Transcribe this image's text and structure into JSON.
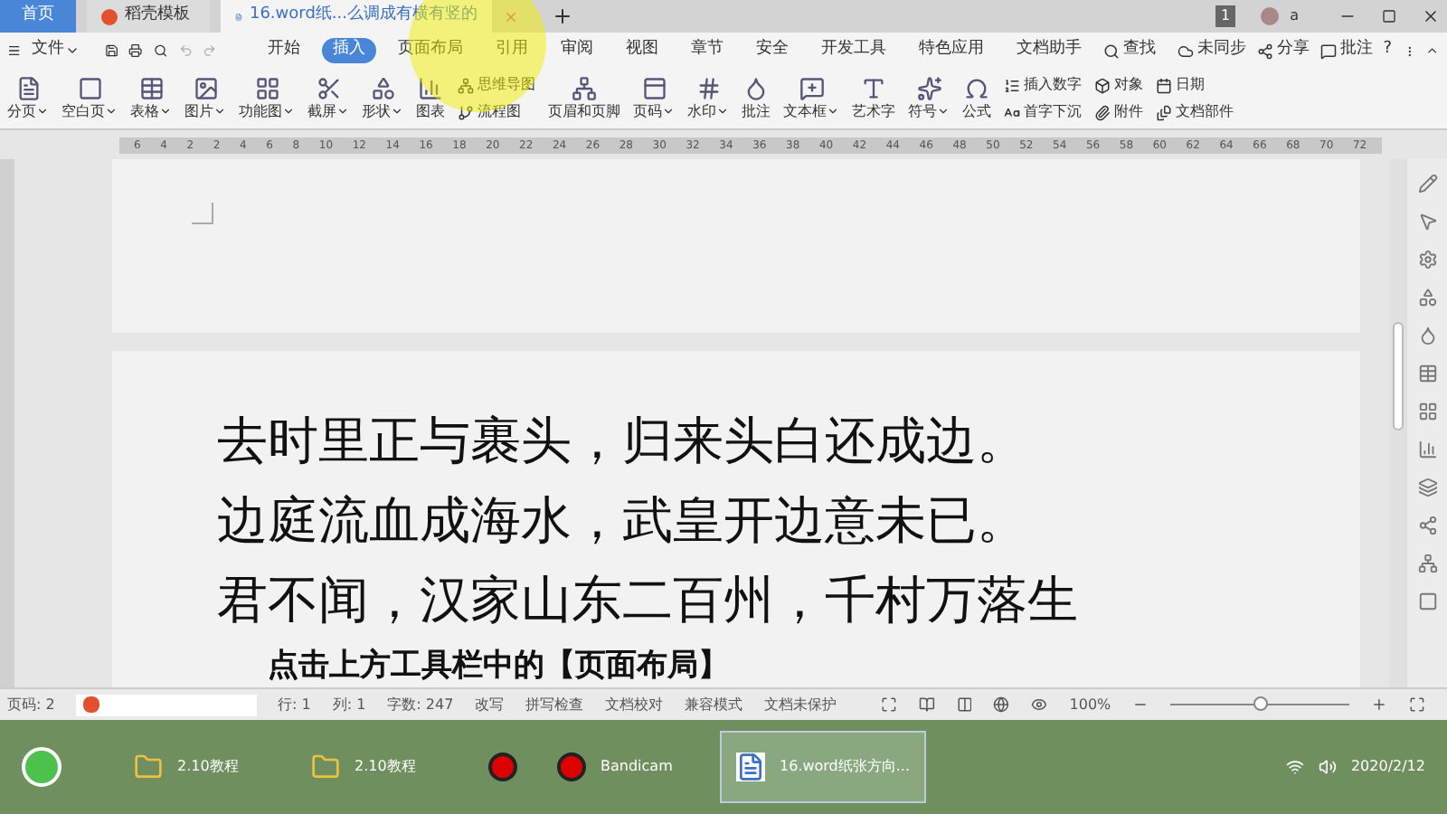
{
  "title_tabs": [
    {
      "label": "首页",
      "kind": "home",
      "selected": false
    },
    {
      "label": "稻壳模板",
      "kind": "template",
      "selected": false
    },
    {
      "label": "16.word纸...么调成有横有竖的",
      "kind": "doc",
      "selected": true
    }
  ],
  "title_bar": {
    "badge": "1",
    "user": "a"
  },
  "menu": {
    "file": "文件",
    "tabs": [
      {
        "label": "开始",
        "selected": false
      },
      {
        "label": "插入",
        "selected": true
      },
      {
        "label": "页面布局",
        "selected": false
      },
      {
        "label": "引用",
        "selected": false
      },
      {
        "label": "审阅",
        "selected": false
      },
      {
        "label": "视图",
        "selected": false
      },
      {
        "label": "章节",
        "selected": false
      },
      {
        "label": "安全",
        "selected": false
      },
      {
        "label": "开发工具",
        "selected": false
      },
      {
        "label": "特色应用",
        "selected": false
      },
      {
        "label": "文档助手",
        "selected": false
      }
    ],
    "search": "查找",
    "sync": "未同步",
    "share": "分享",
    "comment": "批注",
    "help": "?"
  },
  "ribbon": [
    {
      "kind": "big",
      "label": "分页",
      "dropdown": true
    },
    {
      "kind": "big",
      "label": "空白页",
      "dropdown": true
    },
    {
      "kind": "big",
      "label": "表格",
      "dropdown": true
    },
    {
      "kind": "big",
      "label": "图片",
      "dropdown": true
    },
    {
      "kind": "big",
      "label": "功能图",
      "dropdown": true
    },
    {
      "kind": "big",
      "label": "截屏",
      "dropdown": true
    },
    {
      "kind": "big",
      "label": "形状",
      "dropdown": true
    },
    {
      "kind": "big",
      "label": "图表",
      "dropdown": false
    },
    {
      "kind": "pair",
      "top": "思维导图",
      "bottom": "流程图"
    },
    {
      "kind": "big",
      "label": "页眉和页脚",
      "dropdown": false
    },
    {
      "kind": "big",
      "label": "页码",
      "dropdown": true
    },
    {
      "kind": "big",
      "label": "水印",
      "dropdown": true
    },
    {
      "kind": "big",
      "label": "批注",
      "dropdown": false
    },
    {
      "kind": "big",
      "label": "文本框",
      "dropdown": true
    },
    {
      "kind": "big",
      "label": "艺术字",
      "dropdown": false
    },
    {
      "kind": "big",
      "label": "符号",
      "dropdown": true
    },
    {
      "kind": "big",
      "label": "公式",
      "dropdown": false
    },
    {
      "kind": "pair",
      "top": "插入数字",
      "bottom": "首字下沉"
    },
    {
      "kind": "pair",
      "top": "对象",
      "bottom": "附件"
    },
    {
      "kind": "pair",
      "top": "日期",
      "bottom": "文档部件"
    }
  ],
  "ruler": [
    "6",
    "4",
    "2",
    "2",
    "4",
    "6",
    "8",
    "10",
    "12",
    "14",
    "16",
    "18",
    "20",
    "22",
    "24",
    "26",
    "28",
    "30",
    "32",
    "34",
    "36",
    "38",
    "40",
    "42",
    "44",
    "46",
    "48",
    "50",
    "52",
    "54",
    "56",
    "58",
    "60",
    "62",
    "64",
    "66",
    "68",
    "70",
    "72"
  ],
  "document": {
    "lines": [
      "去时里正与裹头，归来头白还成边。",
      "边庭流血成海水，武皇开边意未已。",
      "君不闻，汉家山东二百州，千村万落生"
    ]
  },
  "caption": "点击上方工具栏中的【页面布局】",
  "status_bar": {
    "page": "页码: 2",
    "row": "行: 1",
    "col": "列: 1",
    "words": "字数: 247",
    "items": [
      "改写",
      "拼写检查",
      "文档校对",
      "兼容模式",
      "文档未保护"
    ],
    "zoom": "100%",
    "zoom_slider": {
      "level": 0.5
    }
  },
  "taskbar": {
    "items": [
      {
        "label": "2.10教程",
        "kind": "folder",
        "selected": false
      },
      {
        "label": "2.10教程",
        "kind": "folder",
        "selected": false
      },
      {
        "kind": "record",
        "selected": false
      },
      {
        "label": "Bandicam",
        "kind": "record",
        "selected": false
      },
      {
        "label": "16.word纸张方向...",
        "kind": "wps",
        "selected": true
      }
    ],
    "date": "2020/2/12"
  }
}
